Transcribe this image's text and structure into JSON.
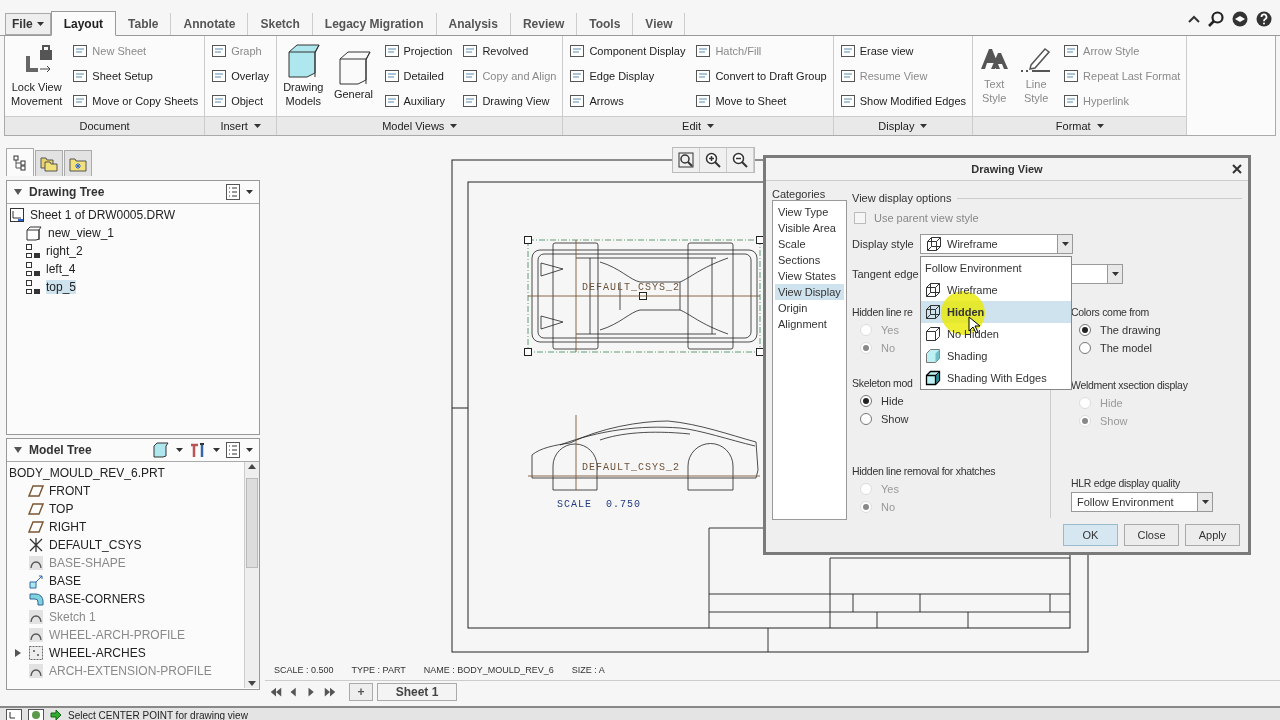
{
  "app_tabs": [
    {
      "label": "File",
      "kind": "menu",
      "selected": false
    },
    {
      "label": "Layout",
      "kind": "tab",
      "selected": true
    },
    {
      "label": "Table",
      "kind": "tab",
      "selected": false
    },
    {
      "label": "Annotate",
      "kind": "tab",
      "selected": false
    },
    {
      "label": "Sketch",
      "kind": "tab",
      "selected": false
    },
    {
      "label": "Legacy Migration",
      "kind": "tab",
      "selected": false
    },
    {
      "label": "Analysis",
      "kind": "tab",
      "selected": false
    },
    {
      "label": "Review",
      "kind": "tab",
      "selected": false
    },
    {
      "label": "Tools",
      "kind": "tab",
      "selected": false
    },
    {
      "label": "View",
      "kind": "tab",
      "selected": false
    }
  ],
  "ribbon_groups": [
    {
      "label": "Document",
      "menu": false,
      "items": [
        {
          "label": "Lock View\nMovement",
          "kind": "large",
          "disabled": false
        },
        {
          "label": "New Sheet",
          "kind": "small",
          "disabled": true
        },
        {
          "label": "Sheet Setup",
          "kind": "small",
          "disabled": false
        },
        {
          "label": "Move or Copy Sheets",
          "kind": "small",
          "disabled": false
        }
      ]
    },
    {
      "label": "Insert",
      "menu": true,
      "items": [
        {
          "label": "Graph",
          "kind": "small",
          "disabled": true
        },
        {
          "label": "Overlay",
          "kind": "small",
          "disabled": false
        },
        {
          "label": "Object",
          "kind": "small",
          "disabled": false
        }
      ]
    },
    {
      "label": "Model Views",
      "menu": true,
      "items": [
        {
          "label": "Drawing\nModels",
          "kind": "large",
          "disabled": false
        },
        {
          "label": "General",
          "kind": "large",
          "disabled": false
        },
        {
          "label": "Projection",
          "kind": "small",
          "disabled": false
        },
        {
          "label": "Detailed",
          "kind": "small",
          "disabled": false
        },
        {
          "label": "Auxiliary",
          "kind": "small",
          "disabled": false
        },
        {
          "label": "Revolved",
          "kind": "small",
          "disabled": false
        },
        {
          "label": "Copy and Align",
          "kind": "small",
          "disabled": true
        },
        {
          "label": "Drawing View",
          "kind": "small",
          "disabled": false
        }
      ]
    },
    {
      "label": "Edit",
      "menu": true,
      "items": [
        {
          "label": "Component Display",
          "kind": "small",
          "disabled": false
        },
        {
          "label": "Edge Display",
          "kind": "small",
          "disabled": false
        },
        {
          "label": "Arrows",
          "kind": "small",
          "disabled": false
        },
        {
          "label": "Hatch/Fill",
          "kind": "small",
          "disabled": true
        },
        {
          "label": "Convert to Draft Group",
          "kind": "small",
          "disabled": false
        },
        {
          "label": "Move to Sheet",
          "kind": "small",
          "disabled": false
        }
      ]
    },
    {
      "label": "Display",
      "menu": true,
      "items": [
        {
          "label": "Erase view",
          "kind": "small",
          "disabled": false
        },
        {
          "label": "Resume View",
          "kind": "small",
          "disabled": true
        },
        {
          "label": "Show Modified Edges",
          "kind": "small",
          "disabled": false
        }
      ]
    },
    {
      "label": "Format",
      "menu": true,
      "items": [
        {
          "label": "Text\nStyle",
          "kind": "large",
          "disabled": true
        },
        {
          "label": "Line\nStyle",
          "kind": "large",
          "disabled": true
        },
        {
          "label": "Arrow Style",
          "kind": "small",
          "disabled": true
        },
        {
          "label": "Repeat Last Format",
          "kind": "small",
          "disabled": true
        },
        {
          "label": "Hyperlink",
          "kind": "small",
          "disabled": true
        }
      ]
    }
  ],
  "navigator_tabs": [
    {
      "selected": true
    },
    {
      "selected": false
    },
    {
      "selected": false
    }
  ],
  "drawing_tree": {
    "title": "Drawing Tree",
    "expanded": true,
    "items": [
      {
        "label": "Sheet 1 of DRW0005.DRW",
        "kind": "sheet",
        "selected": false,
        "children": [
          {
            "label": "new_view_1",
            "kind": "general",
            "selected": false
          },
          {
            "label": "right_2",
            "kind": "projection",
            "selected": false
          },
          {
            "label": "left_4",
            "kind": "projection",
            "selected": false
          },
          {
            "label": "top_5",
            "kind": "projection",
            "selected": true
          }
        ]
      }
    ]
  },
  "model_tree": {
    "title": "Model Tree",
    "expanded": true,
    "items": [
      {
        "label": "BODY_MOULD_REV_6.PRT",
        "dimmed": false,
        "children": [
          {
            "label": "FRONT",
            "kind": "plane",
            "dimmed": false
          },
          {
            "label": "TOP",
            "kind": "plane",
            "dimmed": false
          },
          {
            "label": "RIGHT",
            "kind": "plane",
            "dimmed": false
          },
          {
            "label": "DEFAULT_CSYS",
            "kind": "csys",
            "dimmed": false
          },
          {
            "label": "BASE-SHAPE",
            "kind": "sketch",
            "dimmed": true
          },
          {
            "label": "BASE",
            "kind": "extrude",
            "dimmed": false
          },
          {
            "label": "BASE-CORNERS",
            "kind": "round",
            "dimmed": false
          },
          {
            "label": "Sketch 1",
            "kind": "sketch",
            "dimmed": true
          },
          {
            "label": "WHEEL-ARCH-PROFILE",
            "kind": "sketch",
            "dimmed": true
          },
          {
            "label": "WHEEL-ARCHES",
            "kind": "group",
            "dimmed": false,
            "expanded": false
          },
          {
            "label": "ARCH-EXTENSION-PROFILE",
            "kind": "sketch",
            "dimmed": true
          }
        ]
      }
    ]
  },
  "views": [
    {
      "kind": "top",
      "label": "DEFAULT_CSYS_2",
      "selected": true
    },
    {
      "kind": "side",
      "label": "DEFAULT_CSYS_2",
      "selected": false,
      "note": "SCALE  0.750"
    }
  ],
  "sheet_info": [
    "SCALE : 0.500",
    "TYPE : PART",
    "NAME : BODY_MOULD_REV_6",
    "SIZE : A"
  ],
  "sheet_tabs": {
    "add": "+",
    "tabs": [
      {
        "label": "Sheet 1",
        "selected": true
      }
    ]
  },
  "status_bar": {
    "message": "Select CENTER POINT for drawing view"
  },
  "dialog": {
    "title": "Drawing View",
    "categories_label": "Categories",
    "categories": [
      {
        "label": "View Type",
        "selected": false
      },
      {
        "label": "Visible Area",
        "selected": false
      },
      {
        "label": "Scale",
        "selected": false
      },
      {
        "label": "Sections",
        "selected": false
      },
      {
        "label": "View States",
        "selected": false
      },
      {
        "label": "View Display",
        "selected": true
      },
      {
        "label": "Origin",
        "selected": false
      },
      {
        "label": "Alignment",
        "selected": false
      }
    ],
    "section_title": "View display options",
    "use_parent_view_style": {
      "label": "Use parent view style",
      "checked": false,
      "disabled": true
    },
    "display_style": {
      "label": "Display style",
      "value": "Wireframe",
      "kind": "wire"
    },
    "display_style_options": [
      {
        "label": "Follow Environment",
        "kind": "plain",
        "selected": false
      },
      {
        "label": "Wireframe",
        "kind": "wire",
        "selected": false
      },
      {
        "label": "Hidden",
        "kind": "wire",
        "selected": true
      },
      {
        "label": "No Hidden",
        "kind": "box",
        "selected": false
      },
      {
        "label": "Shading",
        "kind": "shaded",
        "selected": false
      },
      {
        "label": "Shading With Edges",
        "kind": "shaded-edges",
        "selected": false
      }
    ],
    "tangent_edge": {
      "label": "Tangent edge"
    },
    "left_groups": [
      {
        "label": "Hidden line re",
        "options": [
          {
            "label": "Yes",
            "selected": false,
            "disabled": true
          },
          {
            "label": "No",
            "selected": true,
            "disabled": true
          }
        ]
      },
      {
        "label": "Skeleton mod",
        "options": [
          {
            "label": "Hide",
            "selected": true,
            "disabled": false
          },
          {
            "label": "Show",
            "selected": false,
            "disabled": false
          }
        ]
      },
      {
        "label": "Hidden line removal for xhatches",
        "options": [
          {
            "label": "Yes",
            "selected": false,
            "disabled": true
          },
          {
            "label": "No",
            "selected": true,
            "disabled": true
          }
        ]
      }
    ],
    "right_groups": [
      {
        "label": "Colors come from",
        "options": [
          {
            "label": "The drawing",
            "selected": true,
            "disabled": false
          },
          {
            "label": "The model",
            "selected": false,
            "disabled": false
          }
        ]
      },
      {
        "label": "Weldment xsection display",
        "options": [
          {
            "label": "Hide",
            "selected": false,
            "disabled": true
          },
          {
            "label": "Show",
            "selected": true,
            "disabled": true
          }
        ]
      }
    ],
    "hlr_quality": {
      "label": "HLR edge display quality",
      "value": "Follow Environment"
    },
    "buttons": [
      {
        "label": "OK",
        "default": true
      },
      {
        "label": "Close",
        "default": false
      },
      {
        "label": "Apply",
        "default": false
      }
    ]
  }
}
